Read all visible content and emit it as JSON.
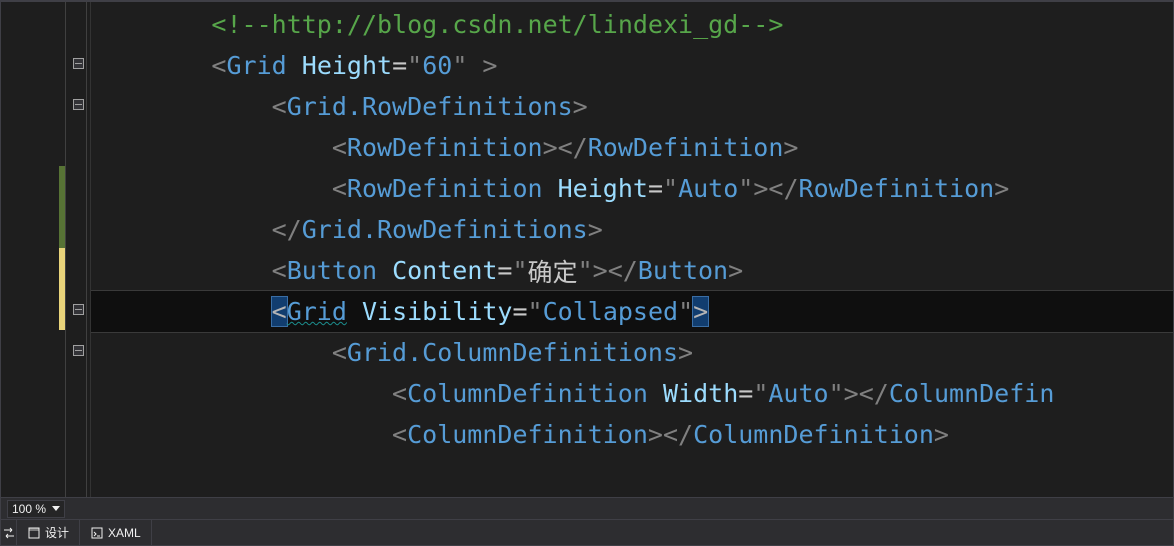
{
  "zoom": {
    "value": "100 %"
  },
  "tabs": {
    "design": {
      "label": "设计"
    },
    "xaml": {
      "label": "XAML"
    }
  },
  "code": {
    "ind1": "        ",
    "ind2": "            ",
    "ind3": "                ",
    "ind4": "                    ",
    "comment_open": "<!--",
    "comment_text": "http://blog.csdn.net/lindexi_gd",
    "comment_close": "-->",
    "lt": "<",
    "lts": "</",
    "gt": ">",
    "gts": " >",
    "eq": "=",
    "q": "\"",
    "sp": " ",
    "grid": "Grid",
    "height_attr": "Height",
    "height_val": "60",
    "grid_rowdefs": "Grid.RowDefinitions",
    "rowdef": "RowDefinition",
    "auto": "Auto",
    "button": "Button",
    "content_attr": "Content",
    "content_val": "确定",
    "visibility_attr": "Visibility",
    "collapsed": "Collapsed",
    "grid_coldefs": "Grid.ColumnDefinitions",
    "coldef": "ColumnDefinition",
    "width_attr": "Width",
    "coldef_cut": "ColumnDefin"
  }
}
